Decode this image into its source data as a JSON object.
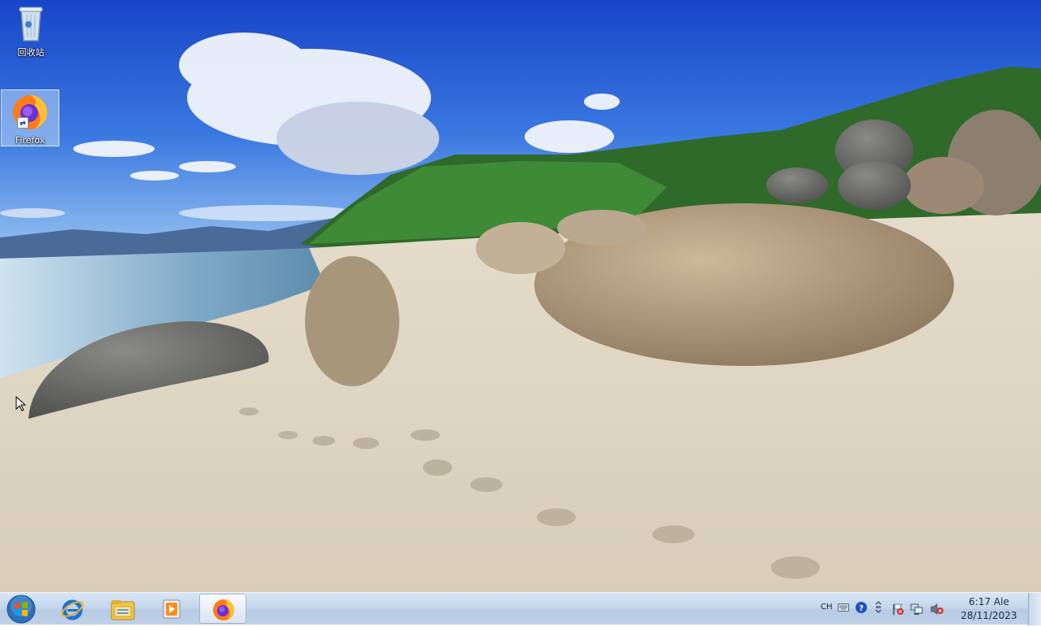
{
  "desktop": {
    "icons": [
      {
        "label": "回收站",
        "icon": "recycle-bin-icon"
      },
      {
        "label": "Firefox",
        "icon": "firefox-icon",
        "shortcut": true
      }
    ]
  },
  "taskbar": {
    "start": "windows-start-icon",
    "pinned": [
      {
        "icon": "internet-explorer-icon"
      },
      {
        "icon": "windows-explorer-icon"
      },
      {
        "icon": "media-player-icon"
      },
      {
        "icon": "firefox-icon",
        "active": true
      }
    ],
    "tray": {
      "language": "CH",
      "icons": [
        "keyboard-icon",
        "help-icon",
        "tray-overflow-icon",
        "action-center-flag-icon",
        "network-icon",
        "volume-muted-icon"
      ]
    },
    "clock": {
      "time": "6:17 Ale",
      "date": "28/11/2023"
    }
  }
}
